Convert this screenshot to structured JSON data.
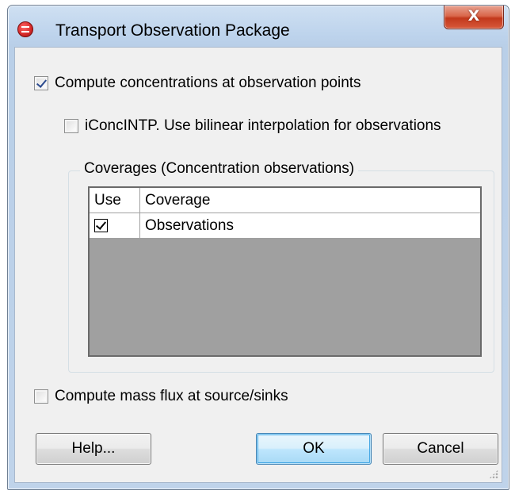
{
  "window": {
    "title": "Transport Observation Package",
    "close_label": "X"
  },
  "options": {
    "compute_concentrations": {
      "label": "Compute concentrations at observation points",
      "checked": true
    },
    "iconcintp": {
      "label": "iConcINTP. Use bilinear interpolation for observations",
      "checked": false
    },
    "compute_mass_flux": {
      "label": "Compute mass flux at source/sinks",
      "checked": false
    }
  },
  "coverages": {
    "group_title": "Coverages (Concentration observations)",
    "columns": [
      "Use",
      "Coverage"
    ],
    "rows": [
      {
        "use": true,
        "coverage": "Observations"
      }
    ]
  },
  "buttons": {
    "help": "Help...",
    "ok": "OK",
    "cancel": "Cancel"
  },
  "colors": {
    "accent": "#48a9e5",
    "close_red": "#c2391c",
    "grid_empty": "#a0a0a0"
  }
}
